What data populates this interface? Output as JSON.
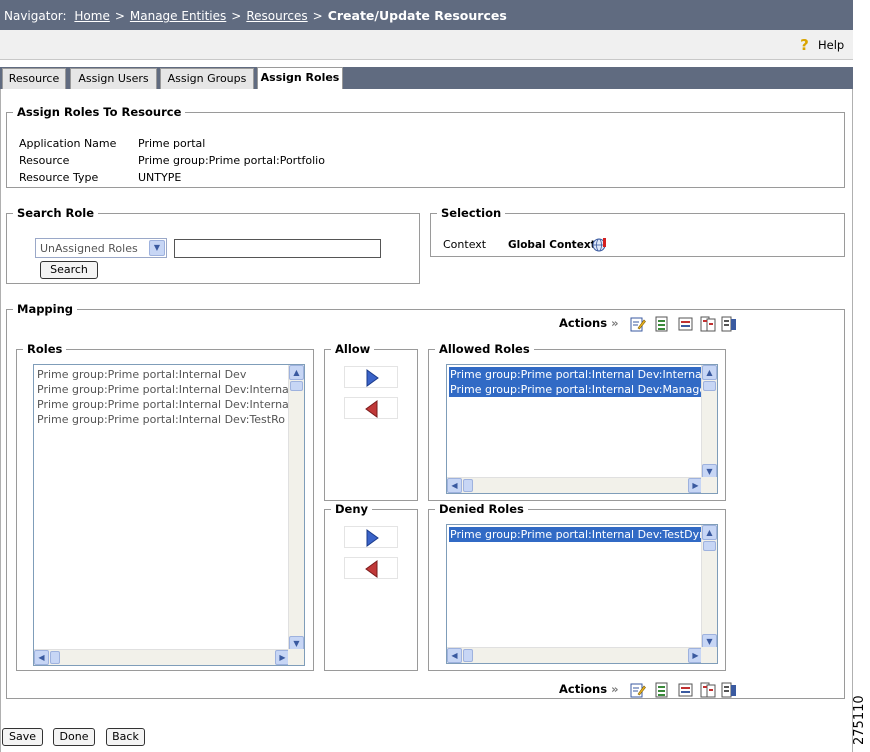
{
  "navigator": {
    "label": "Navigator:",
    "links": [
      "Home",
      "Manage Entities",
      "Resources"
    ],
    "separator": ">",
    "current": "Create/Update Resources"
  },
  "help": {
    "label": "Help",
    "icon": "help-icon"
  },
  "tabs": [
    {
      "label": "Resource",
      "active": false
    },
    {
      "label": "Assign Users",
      "active": false
    },
    {
      "label": "Assign Groups",
      "active": false
    },
    {
      "label": "Assign Roles",
      "active": true
    }
  ],
  "assign_section": {
    "title": "Assign Roles To Resource",
    "rows": [
      {
        "label": "Application Name",
        "value": "Prime portal"
      },
      {
        "label": "Resource",
        "value": "Prime group:Prime portal:Portfolio"
      },
      {
        "label": "Resource Type",
        "value": "UNTYPE"
      }
    ]
  },
  "search_role": {
    "title": "Search Role",
    "dropdown_selected": "UnAssigned Roles",
    "input_value": "",
    "search_button": "Search"
  },
  "selection": {
    "title": "Selection",
    "context_label": "Context",
    "context_value": "Global Context",
    "context_icon": "globe-icon"
  },
  "mapping": {
    "title": "Mapping",
    "actions_label": "Actions",
    "actions_chevron": "»",
    "action_icons": [
      "edit-icon",
      "check-list-icon",
      "remove-list-icon",
      "copy-list-icon",
      "info-list-icon"
    ],
    "roles": {
      "title": "Roles",
      "items": [
        "Prime group:Prime portal:Internal Dev",
        "Prime group:Prime portal:Internal Dev:Internal",
        "Prime group:Prime portal:Internal Dev:Internal",
        "Prime group:Prime portal:Internal Dev:TestRo"
      ]
    },
    "allow": {
      "title": "Allow"
    },
    "deny": {
      "title": "Deny"
    },
    "allowed_roles": {
      "title": "Allowed Roles",
      "items": [
        "Prime group:Prime portal:Internal Dev:Internal",
        "Prime group:Prime portal:Internal Dev:Manage"
      ]
    },
    "denied_roles": {
      "title": "Denied Roles",
      "items": [
        "Prime group:Prime portal:Internal Dev:TestDyr"
      ]
    }
  },
  "footer_buttons": [
    "Save",
    "Done",
    "Back"
  ],
  "figure_number": "275110"
}
